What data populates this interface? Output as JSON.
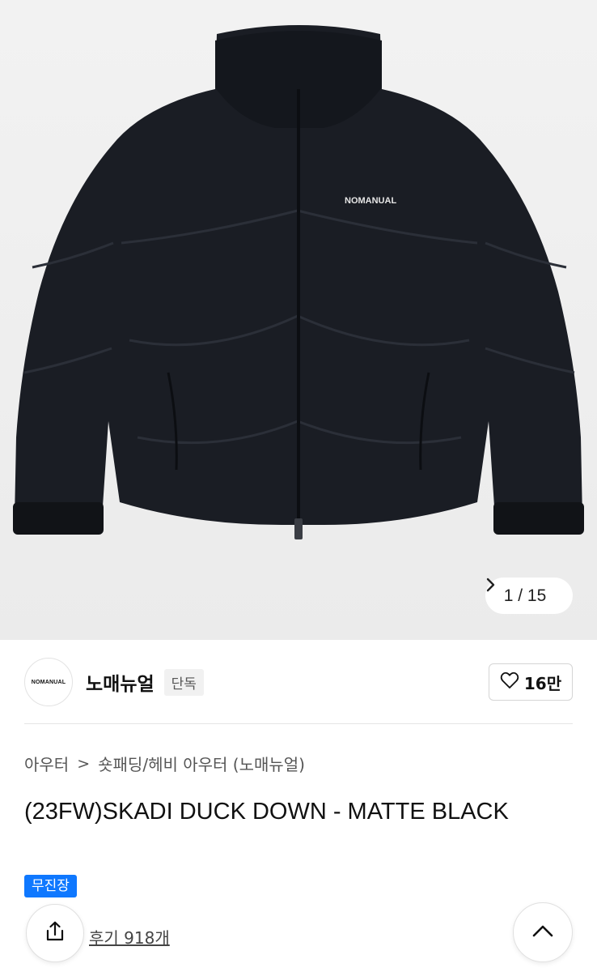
{
  "gallery": {
    "current": "1",
    "separator": "/",
    "total": "15",
    "next_icon": "chevron-right-icon",
    "jacket_logo_text": "NOMANUAL"
  },
  "brand": {
    "logo_text": "NOMANUAL",
    "name": "노매뉴얼",
    "badge": "단독",
    "likes": "16만"
  },
  "breadcrumb": {
    "category": "아우터",
    "separator": ">",
    "subcategory": "숏패딩/헤비 아우터 (노매뉴얼)"
  },
  "product": {
    "title": "(23FW)SKADI DUCK DOWN - MATTE BLACK",
    "tag": "무진장"
  },
  "footer": {
    "reviews": "후기 918개"
  },
  "colors": {
    "accent": "#0f78ff",
    "jacket": "#1a1d24"
  }
}
